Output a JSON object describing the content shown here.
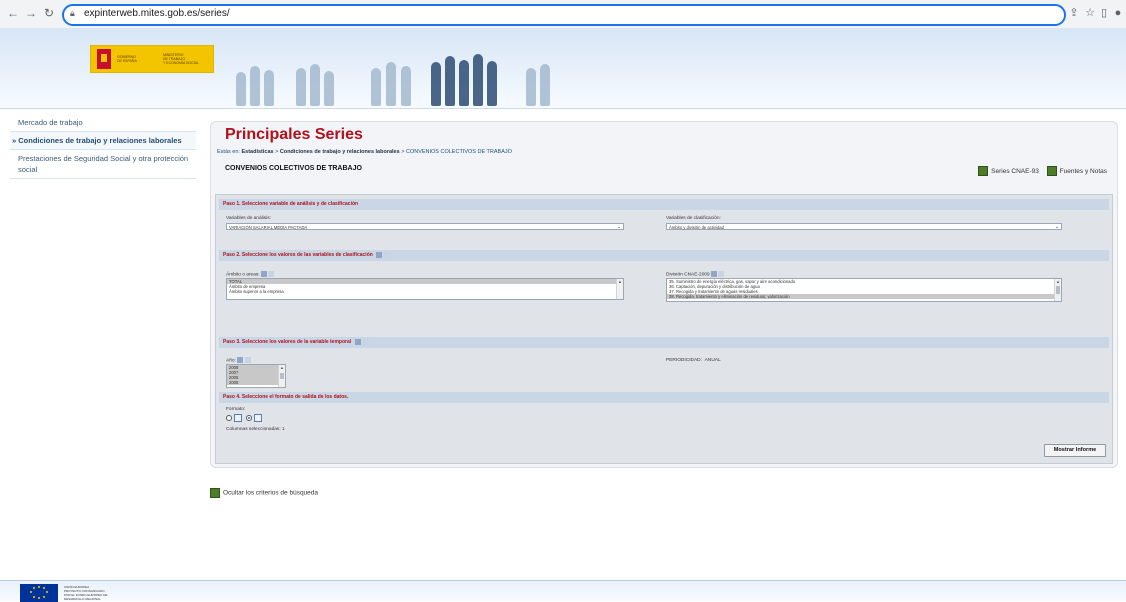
{
  "browser": {
    "url": "expinterweb.mites.gob.es/series/",
    "icons": [
      "back-arrow-icon",
      "forward-arrow-icon",
      "reload-icon",
      "lock-icon",
      "share-icon",
      "star-icon",
      "sidebar-icon",
      "profile-icon"
    ]
  },
  "banner": {
    "gov_text1": "GOBIERNO",
    "gov_text2": "DE ESPAÑA",
    "ministry_text1": "MINISTERIO",
    "ministry_text2": "DE TRABAJO",
    "ministry_text3": "Y ECONOMÍA SOCIAL"
  },
  "sidebar": {
    "items": [
      {
        "label": "Mercado de trabajo"
      },
      {
        "label": "» Condiciones de trabajo y relaciones laborales"
      },
      {
        "label": "Prestaciones de Seguridad Social y otra protección social"
      }
    ]
  },
  "main": {
    "title": "Principales Series",
    "breadcrumb_prefix": "Estás en:",
    "breadcrumb_1": "Estadísticas",
    "breadcrumb_sep": ">",
    "breadcrumb_2": "Condiciones de trabajo y relaciones laborales",
    "breadcrumb_3": "CONVENIOS COLECTIVOS DE TRABAJO",
    "section_title": "CONVENIOS COLECTIVOS DE TRABAJO",
    "link_series": "Series CNAE-93",
    "link_fuentes": "Fuentes y Notas"
  },
  "step1": {
    "title": "Paso 1. Seleccione variable de análisis y de clasificación",
    "analysis_label": "Variables de análisis:",
    "analysis_value": "VARIACIÓN SALARIAL MEDIA PACTADA",
    "class_label": "Variables de clasificación:",
    "class_value": "Ámbito y división de actividad"
  },
  "step2": {
    "title": "Paso 2. Seleccione los valores de las variables de clasificación",
    "ambito_label": "Ámbito o areas:",
    "ambito_options": [
      "TOTAL",
      "Ámbito de empresa",
      "Ámbito superior a la empresa"
    ],
    "cnae_label": "División CNAE-2009",
    "cnae_options": [
      "35. Suministro de energía eléctrica, gas, vapor y aire acondicionado",
      "36. Captación, depuración y distribución de agua",
      "37. Recogida y tratamiento de aguas residuales",
      "38. Recogida, tratamiento y eliminación de residuos; valorización"
    ]
  },
  "step3": {
    "title": "Paso 3. Seleccione los valores de la variable temporal",
    "year_label": "Año:",
    "years": [
      "2008",
      "2007",
      "2006",
      "2005"
    ],
    "periodicity_label": "PERIODICIDAD:",
    "periodicity_value": "ANUAL"
  },
  "step4": {
    "title": "Paso 4. Seleccione el formato de salida de los datos.",
    "format_label": "Formato:",
    "columns_label": "Columnas seleccionadas: 1",
    "button": "Mostrar Informe"
  },
  "hide_criteria": "Ocultar los criterios de búsqueda",
  "footer": {
    "eu_line1": "UNIÓN EUROPEA",
    "eu_line2": "PROYECTO COFINANCIADO",
    "eu_line3": "POR EL FONDO EUROPEO DE",
    "eu_line4": "DESARROLLO REGIONAL"
  },
  "colors": {
    "title_red": "#b1111b",
    "link_blue": "#1f4e79",
    "step_bar": "#c8d6e5",
    "green_icon": "#4e7c29"
  }
}
